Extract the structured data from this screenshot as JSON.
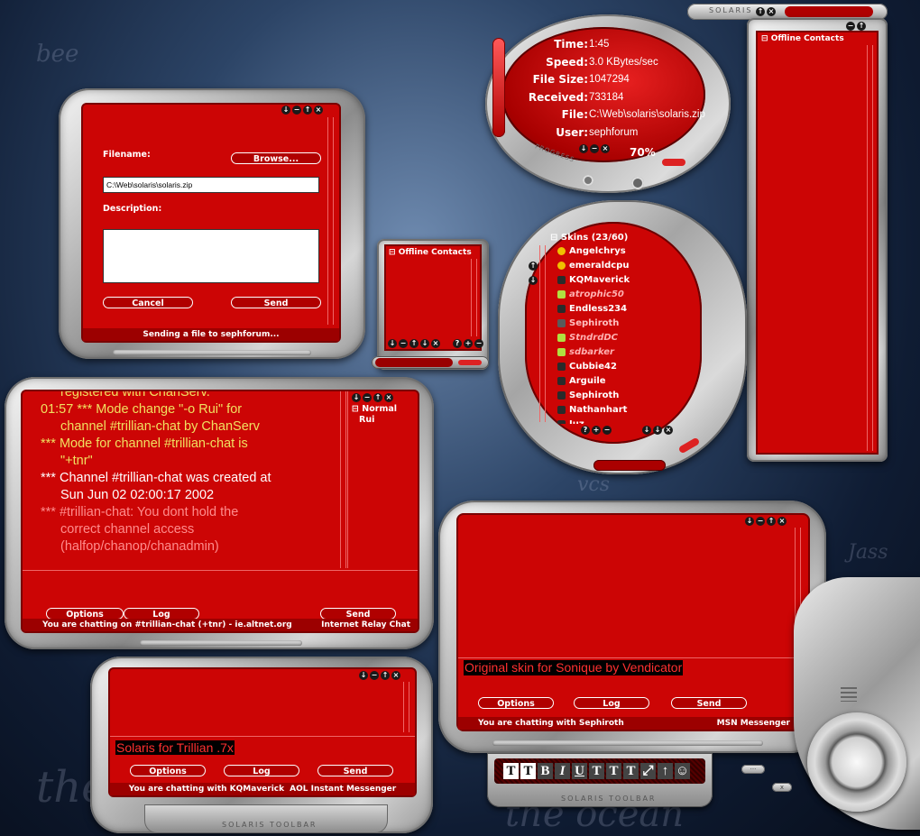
{
  "background": {
    "script_lines": [
      "the",
      "the ocean",
      "Jass",
      "vcs",
      "bee"
    ]
  },
  "top_toolbar": {
    "title": "Solaris"
  },
  "offline_right": {
    "header": "Offline Contacts"
  },
  "transfer": {
    "rows": [
      {
        "label": "Time:",
        "value": "1:45"
      },
      {
        "label": "Speed:",
        "value": "3.0 KBytes/sec"
      },
      {
        "label": "File Size:",
        "value": "1047294"
      },
      {
        "label": "Received:",
        "value": "733184"
      },
      {
        "label": "File:",
        "value": "C:\\Web\\solaris\\solaris.zip"
      },
      {
        "label": "User:",
        "value": "sephforum"
      }
    ],
    "percent": "70%",
    "progress_label": "Progress",
    "progress": 0.7
  },
  "send_file": {
    "filename_label": "Filename:",
    "browse_label": "Browse...",
    "filename_value": "C:\\Web\\solaris\\solaris.zip",
    "description_label": "Description:",
    "cancel_label": "Cancel",
    "send_label": "Send",
    "status": "Sending a file to sephforum..."
  },
  "offline_small": {
    "header": "Offline Contacts"
  },
  "contacts": {
    "header": "Skins (23/60)",
    "items": [
      {
        "name": "Angelchrys",
        "status": "away",
        "italic": false
      },
      {
        "name": "emeraldcpu",
        "status": "away",
        "italic": false
      },
      {
        "name": "KQMaverick",
        "status": "online",
        "italic": false
      },
      {
        "name": "atrophic50",
        "status": "offline",
        "italic": true
      },
      {
        "name": "Endless234",
        "status": "online",
        "italic": false
      },
      {
        "name": "Sephiroth",
        "status": "online-dim",
        "italic": false
      },
      {
        "name": "StndrdDC",
        "status": "offline",
        "italic": true
      },
      {
        "name": "sdbarker",
        "status": "offline",
        "italic": true
      },
      {
        "name": "Cubbie42",
        "status": "online",
        "italic": false
      },
      {
        "name": "Arguile",
        "status": "online",
        "italic": false
      },
      {
        "name": "Sephiroth",
        "status": "online",
        "italic": false
      },
      {
        "name": "Nathanhart",
        "status": "online",
        "italic": false
      },
      {
        "name": "Juz",
        "status": "online",
        "italic": false
      }
    ]
  },
  "irc": {
    "lines": [
      {
        "prefix": "",
        "text": "registered with ChanServ.",
        "color": "#f0e060"
      },
      {
        "prefix": "01:57 *** ",
        "text": "Mode change \"-o Rui\" for",
        "color": "#f0e060"
      },
      {
        "prefix": "",
        "text": "channel #trillian-chat by ChanServ",
        "color": "#f0e060"
      },
      {
        "prefix": "*** ",
        "text": "Mode for channel #trillian-chat is",
        "color": "#f0e060"
      },
      {
        "prefix": "",
        "text": "\"+tnr\"",
        "color": "#f0e060"
      },
      {
        "prefix": "*** ",
        "text": "Channel #trillian-chat was created at",
        "color": "#ffffff"
      },
      {
        "prefix": "",
        "text": "Sun Jun 02 02:00:17 2002",
        "color": "#ffffff"
      },
      {
        "prefix": "*** ",
        "text": "#trillian-chat: You dont hold the",
        "color": "#ff8c8c"
      },
      {
        "prefix": "",
        "text": "correct channel access",
        "color": "#ff8c8c"
      },
      {
        "prefix": "",
        "text": "(halfop/chanop/chanadmin)",
        "color": "#ff8c8c"
      }
    ],
    "user_group": "Normal",
    "users": [
      "Rui"
    ],
    "options_label": "Options",
    "log_label": "Log",
    "send_label": "Send",
    "status_left": "You are chatting on #trillian-chat (+tnr) - ie.altnet.org",
    "status_right": "Internet Relay Chat"
  },
  "aim": {
    "input_text": "Solaris for Trillian .7x",
    "options_label": "Options",
    "log_label": "Log",
    "send_label": "Send",
    "status_left": "You are chatting with KQMaverick",
    "status_right": "AOL Instant Messenger"
  },
  "msn": {
    "input_text": "Original skin for Sonique by Vendicator",
    "options_label": "Options",
    "log_label": "Log",
    "send_label": "Send",
    "status_left": "You are chatting with Sephiroth",
    "status_right": "MSN Messenger"
  },
  "format_toolbar": {
    "buttons": [
      "T",
      "T",
      "B",
      "I",
      "U",
      "T",
      "T",
      "T",
      "⤢",
      "↑",
      "☺"
    ],
    "title": "Solaris Toolbar"
  },
  "bottom_toolbar": {
    "title": "Solaris Toolbar"
  },
  "dial": {
    "btn1": "···",
    "btn2": "x"
  }
}
